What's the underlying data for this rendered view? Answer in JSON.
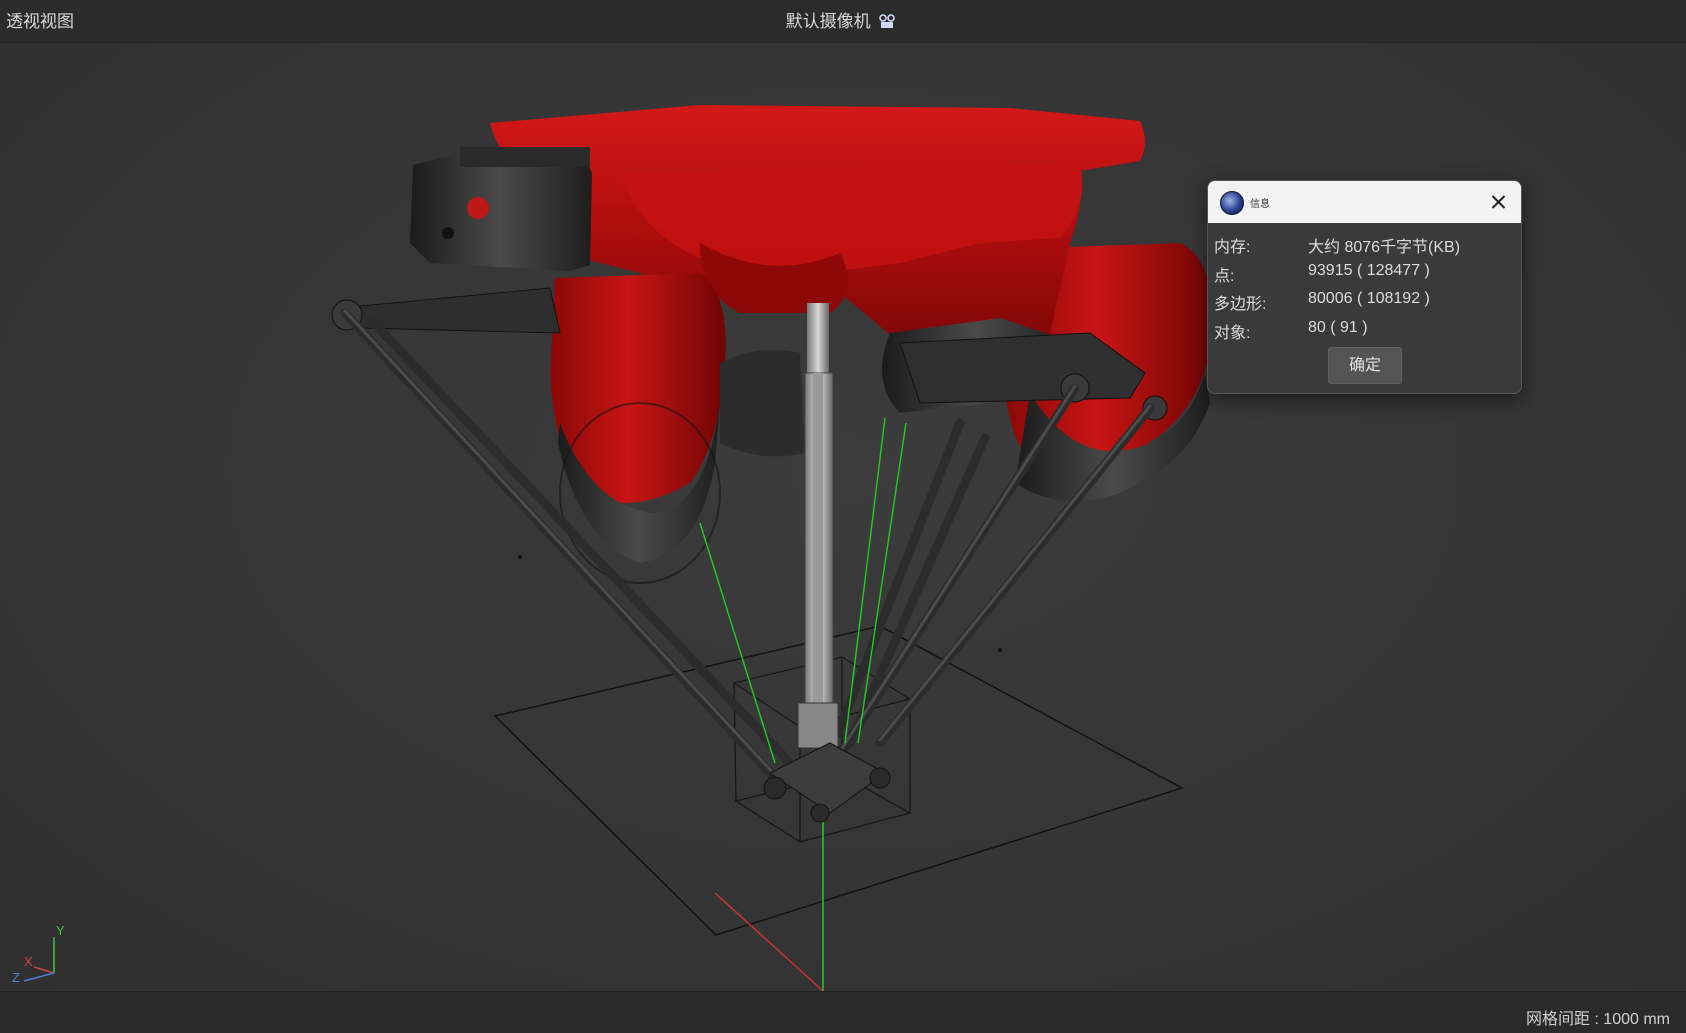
{
  "header": {
    "view_name": "透视视图",
    "camera_name": "默认摄像机"
  },
  "status": {
    "grid_spacing": "网格间距 : 1000 mm"
  },
  "axis_gizmo": {
    "y": "Y",
    "x": "X",
    "z": "Z"
  },
  "dialog": {
    "title": "信息",
    "rows": [
      {
        "label": "内存:",
        "value": "大约 8076千字节(KB)"
      },
      {
        "label": "点:",
        "value": "93915 ( 128477 )"
      },
      {
        "label": "多边形:",
        "value": "80006 ( 108192 )"
      },
      {
        "label": "对象:",
        "value": "80 ( 91 )"
      }
    ],
    "ok_label": "确定"
  },
  "colors": {
    "robot_red": "#b01010",
    "arm_gray": "#3a3a3a",
    "green_axis": "#22cc22",
    "red_axis": "#cc3333",
    "blue_axis": "#3366cc"
  }
}
